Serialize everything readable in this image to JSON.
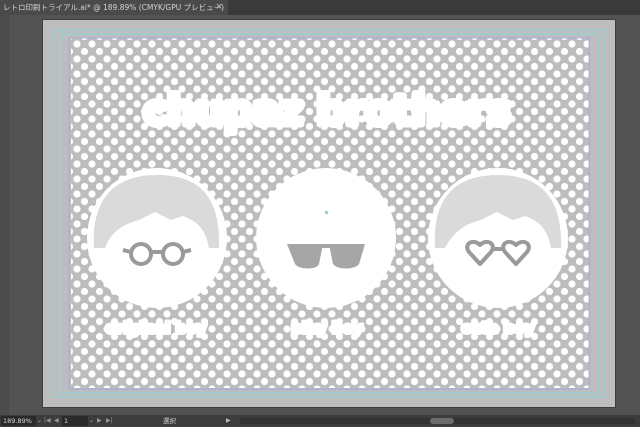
{
  "document": {
    "tab_title": "レトロ印刷トライアル.ai* @ 189.89% (CMYK/GPU プレビュー)",
    "close_glyph": "×"
  },
  "artwork": {
    "headline": "chupaz brothers",
    "characters": [
      {
        "label": "original boy",
        "eyewear": "round-glasses"
      },
      {
        "label": "play boy",
        "eyewear": "sunglasses"
      },
      {
        "label": "cute boy",
        "eyewear": "heart-glasses"
      }
    ],
    "colors": {
      "artboard": "#bdbdbd",
      "ink": "#ffffff",
      "hair": "#dadada",
      "glasses": "#9a9a9a",
      "guide": "#7fdbe6"
    }
  },
  "statusbar": {
    "zoom": "189.89%",
    "zoom_arrow": "⌄",
    "first_glyph": "|◀",
    "prev_glyph": "◀",
    "page": "1",
    "page_arrow": "⌄",
    "next_glyph": "▶",
    "last_glyph": "▶|",
    "tool_status": "選択",
    "status_arrow": "▶"
  }
}
